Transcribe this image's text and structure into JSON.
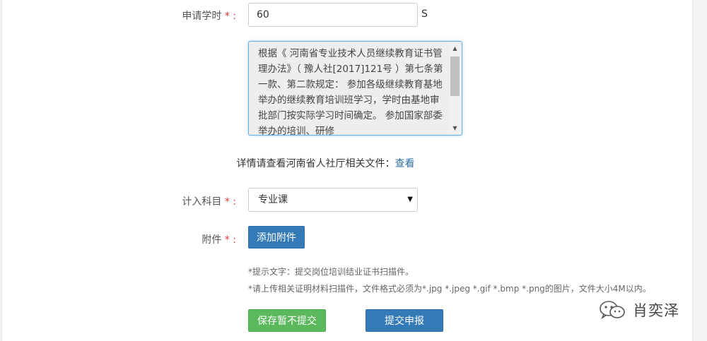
{
  "form": {
    "hours": {
      "label": "申请学时",
      "required_mark": " * :",
      "value": "60",
      "unit": "S"
    },
    "regulation_text": "根据《 河南省专业技术人员继续教育证书管理办法》（ 豫人社[2017]121号 ）第七条第一款、第二款规定： 参加各级继续教育基地举办的继续教育培训班学习，学时由基地审批部门按实际学习时间确定。 参加国家部委举办的培训、研修",
    "detail": {
      "text": "详情请查看河南省人社厅相关文件：",
      "link": "查看"
    },
    "subject": {
      "label": "计入科目",
      "required_mark": " * :",
      "selected": "专业课"
    },
    "attachment": {
      "label": "附件",
      "required_mark": " * :",
      "button": "添加附件"
    },
    "hints": [
      "*提示文字：提交岗位培训结业证书扫描件。",
      "*请上传相关证明材料扫描件，文件格式必须为*.jpg *.jpeg *.gif *.bmp *.png的图片，文件大小4M以内。"
    ],
    "actions": {
      "save_draft": "保存暂不提交",
      "submit": "提交申报"
    }
  },
  "watermark": {
    "text": "肖奕泽",
    "icon": "wechat-icon"
  },
  "colors": {
    "primary": "#337ab7",
    "success": "#5cb85c",
    "required": "#e4393c",
    "link": "#2e6da4"
  }
}
